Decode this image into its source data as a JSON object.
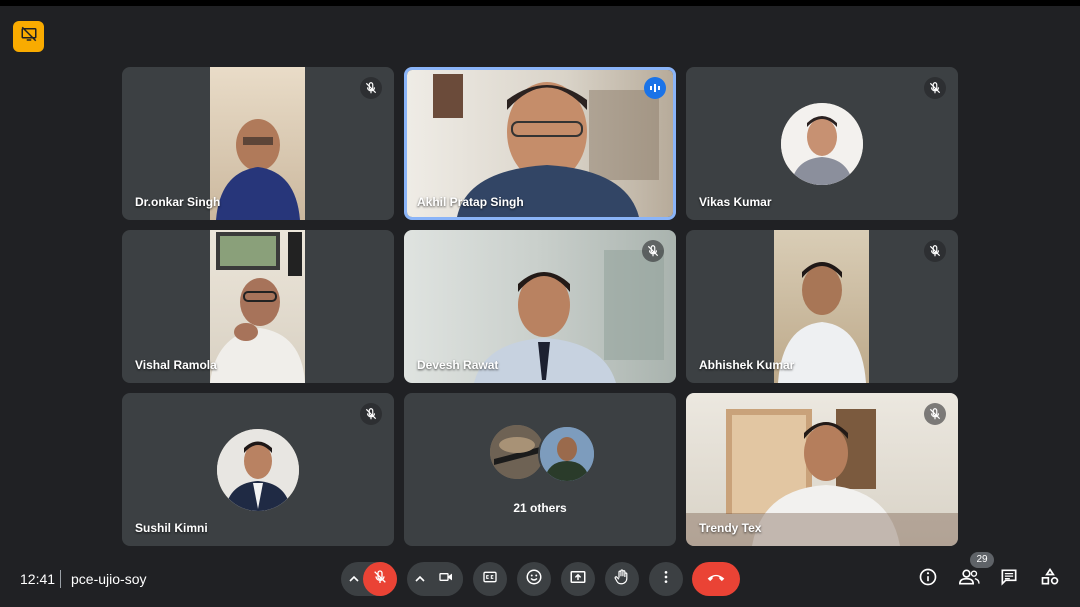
{
  "meeting": {
    "time": "12:41",
    "code": "pce-ujio-soy",
    "participant_count": "29"
  },
  "participants": [
    {
      "name": "Dr.onkar Singh"
    },
    {
      "name": "Akhil Pratap Singh"
    },
    {
      "name": "Vikas Kumar"
    },
    {
      "name": "Vishal Ramola"
    },
    {
      "name": "Devesh Rawat"
    },
    {
      "name": "Abhishek Kumar"
    },
    {
      "name": "Sushil Kimni"
    },
    {
      "name": "Trendy Tex"
    }
  ],
  "others": {
    "label": "21 others"
  },
  "colors": {
    "background": "#202124",
    "tile": "#3c4043",
    "active_border": "#8ab4f8",
    "danger": "#ea4335",
    "speaking_indicator": "#1a73e8",
    "badge": "#f9ab00"
  },
  "icons": {
    "badge": "presentation-off-icon",
    "tile_status": "mic-off-icon",
    "speaking": "audio-level-icon",
    "controls": [
      "chevron-up-icon",
      "mic-off-icon",
      "chevron-up-icon",
      "camera-icon",
      "captions-icon",
      "emoji-icon",
      "present-icon",
      "raise-hand-icon",
      "more-vert-icon",
      "end-call-icon"
    ],
    "side": [
      "info-icon",
      "people-icon",
      "chat-icon",
      "activities-icon"
    ]
  }
}
